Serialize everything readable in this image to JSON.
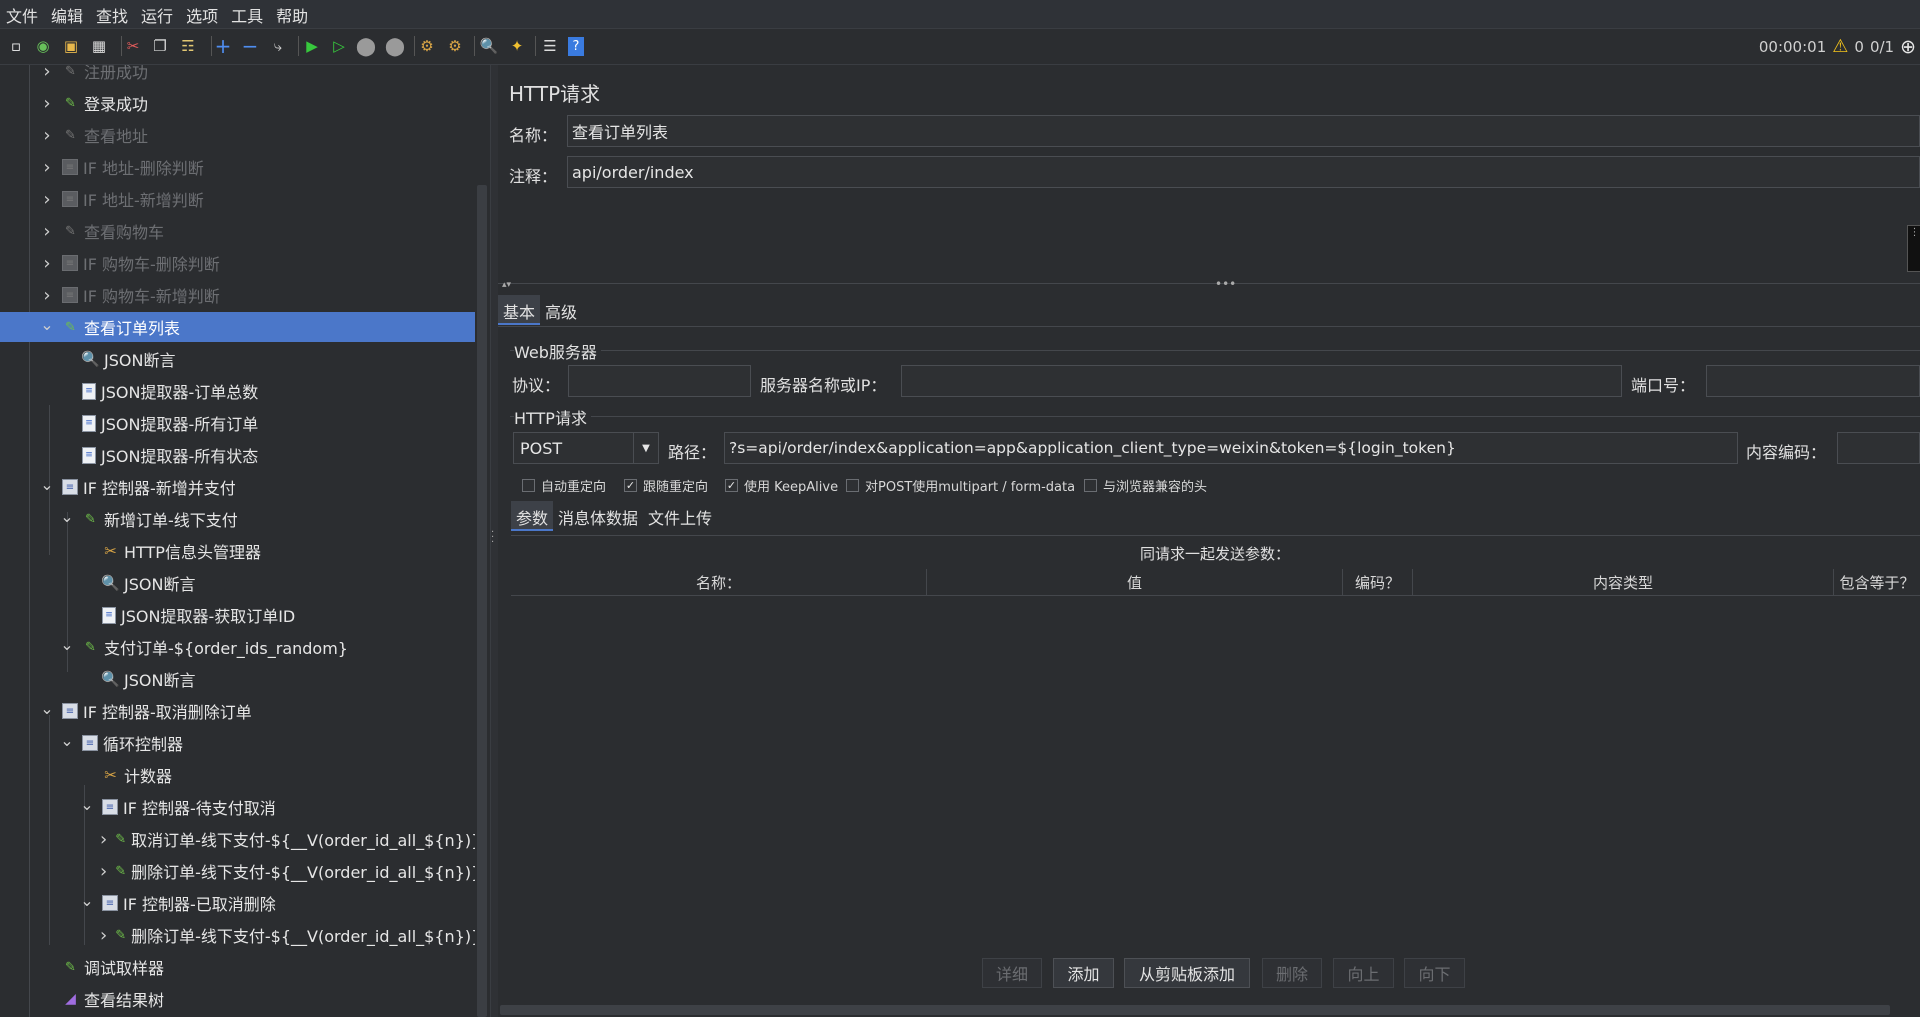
{
  "menu": [
    "文件",
    "编辑",
    "查找",
    "运行",
    "选项",
    "工具",
    "帮助"
  ],
  "toolbar": {
    "icons": [
      "new-icon",
      "templates-icon",
      "open-icon",
      "save-icon",
      "cut-icon",
      "copy-icon",
      "paste-icon",
      "expand-icon",
      "collapse-icon",
      "toggle-icon",
      "start-icon",
      "start-no-pause-icon",
      "stop-icon",
      "shutdown-icon",
      "clear-icon",
      "clear-all-icon",
      "search-icon",
      "reset-search-icon",
      "function-helper-icon",
      "help-icon"
    ],
    "timer": "00:00:01",
    "warning_count": "0",
    "threads": "0/1"
  },
  "tree": [
    {
      "label": "注册成功",
      "level": 1,
      "icon": "sampler",
      "disabled": true,
      "twisty": ">"
    },
    {
      "label": "登录成功",
      "level": 1,
      "icon": "sampler",
      "disabled": false,
      "twisty": ">"
    },
    {
      "label": "查看地址",
      "level": 1,
      "icon": "sampler",
      "disabled": true,
      "twisty": ">"
    },
    {
      "label": "IF 地址-删除判断",
      "level": 1,
      "icon": "controller",
      "disabled": true,
      "twisty": ">"
    },
    {
      "label": "IF 地址-新增判断",
      "level": 1,
      "icon": "controller",
      "disabled": true,
      "twisty": ">"
    },
    {
      "label": "查看购物车",
      "level": 1,
      "icon": "sampler",
      "disabled": true,
      "twisty": ">"
    },
    {
      "label": "IF 购物车-删除判断",
      "level": 1,
      "icon": "controller",
      "disabled": true,
      "twisty": ">"
    },
    {
      "label": "IF 购物车-新增判断",
      "level": 1,
      "icon": "controller",
      "disabled": true,
      "twisty": ">"
    },
    {
      "label": "查看订单列表",
      "level": 1,
      "icon": "sampler",
      "disabled": false,
      "twisty": "v",
      "selected": true
    },
    {
      "label": "JSON断言",
      "level": 2,
      "icon": "assertion",
      "disabled": false,
      "twisty": ""
    },
    {
      "label": "JSON提取器-订单总数",
      "level": 2,
      "icon": "extractor",
      "disabled": false,
      "twisty": ""
    },
    {
      "label": "JSON提取器-所有订单",
      "level": 2,
      "icon": "extractor",
      "disabled": false,
      "twisty": ""
    },
    {
      "label": "JSON提取器-所有状态",
      "level": 2,
      "icon": "extractor",
      "disabled": false,
      "twisty": ""
    },
    {
      "label": "IF 控制器-新增并支付",
      "level": 1,
      "icon": "controller",
      "disabled": false,
      "twisty": "v"
    },
    {
      "label": "新增订单-线下支付",
      "level": 2,
      "icon": "sampler",
      "disabled": false,
      "twisty": "v"
    },
    {
      "label": "HTTP信息头管理器",
      "level": 3,
      "icon": "config",
      "disabled": false,
      "twisty": ""
    },
    {
      "label": "JSON断言",
      "level": 3,
      "icon": "assertion",
      "disabled": false,
      "twisty": ""
    },
    {
      "label": "JSON提取器-获取订单ID",
      "level": 3,
      "icon": "extractor",
      "disabled": false,
      "twisty": ""
    },
    {
      "label": "支付订单-${order_ids_random}",
      "level": 2,
      "icon": "sampler",
      "disabled": false,
      "twisty": "v"
    },
    {
      "label": "JSON断言",
      "level": 3,
      "icon": "assertion",
      "disabled": false,
      "twisty": ""
    },
    {
      "label": "IF 控制器-取消删除订单",
      "level": 1,
      "icon": "controller",
      "disabled": false,
      "twisty": "v"
    },
    {
      "label": "循环控制器",
      "level": 2,
      "icon": "controller",
      "disabled": false,
      "twisty": "v"
    },
    {
      "label": "计数器",
      "level": 3,
      "icon": "config",
      "disabled": false,
      "twisty": ""
    },
    {
      "label": "IF 控制器-待支付取消",
      "level": 3,
      "icon": "controller",
      "disabled": false,
      "twisty": "v"
    },
    {
      "label": "取消订单-线下支付-${__V(order_id_all_${n})}",
      "level": 4,
      "icon": "sampler",
      "disabled": false,
      "twisty": ">"
    },
    {
      "label": "删除订单-线下支付-${__V(order_id_all_${n})}",
      "level": 4,
      "icon": "sampler",
      "disabled": false,
      "twisty": ">"
    },
    {
      "label": "IF 控制器-已取消删除",
      "level": 3,
      "icon": "controller",
      "disabled": false,
      "twisty": "v"
    },
    {
      "label": "删除订单-线下支付-${__V(order_id_all_${n})}",
      "level": 4,
      "icon": "sampler",
      "disabled": false,
      "twisty": ">"
    },
    {
      "label": "调试取样器",
      "level": 1,
      "icon": "sampler",
      "disabled": false,
      "twisty": ""
    },
    {
      "label": "查看结果树",
      "level": 1,
      "icon": "listener",
      "disabled": false,
      "twisty": ""
    }
  ],
  "panel": {
    "title": "HTTP请求",
    "name_label": "名称：",
    "name_value": "查看订单列表",
    "comment_label": "注释：",
    "comment_value": "api/order/index",
    "tabs": [
      "基本",
      "高级"
    ],
    "web_server": {
      "legend": "Web服务器",
      "protocol_label": "协议：",
      "protocol_value": "",
      "server_label": "服务器名称或IP：",
      "server_value": "",
      "port_label": "端口号：",
      "port_value": ""
    },
    "http_request": {
      "legend": "HTTP请求",
      "method": "POST",
      "path_label": "路径：",
      "path_value": "?s=api/order/index&application=app&application_client_type=weixin&token=${login_token}",
      "encoding_label": "内容编码：",
      "encoding_value": ""
    },
    "checkboxes": [
      {
        "label": "自动重定向",
        "checked": false
      },
      {
        "label": "跟随重定向",
        "checked": true
      },
      {
        "label": "使用 KeepAlive",
        "checked": true
      },
      {
        "label": "对POST使用multipart / form-data",
        "checked": false
      },
      {
        "label": "与浏览器兼容的头",
        "checked": false
      }
    ],
    "subtabs": [
      "参数",
      "消息体数据",
      "文件上传"
    ],
    "params_caption": "同请求一起发送参数：",
    "columns": [
      "名称：",
      "值",
      "编码？",
      "内容类型",
      "包含等于？"
    ],
    "buttons": [
      {
        "label": "详细",
        "enabled": false
      },
      {
        "label": "添加",
        "enabled": true
      },
      {
        "label": "从剪贴板添加",
        "enabled": true
      },
      {
        "label": "删除",
        "enabled": false
      },
      {
        "label": "向上",
        "enabled": false
      },
      {
        "label": "向下",
        "enabled": false
      }
    ]
  }
}
